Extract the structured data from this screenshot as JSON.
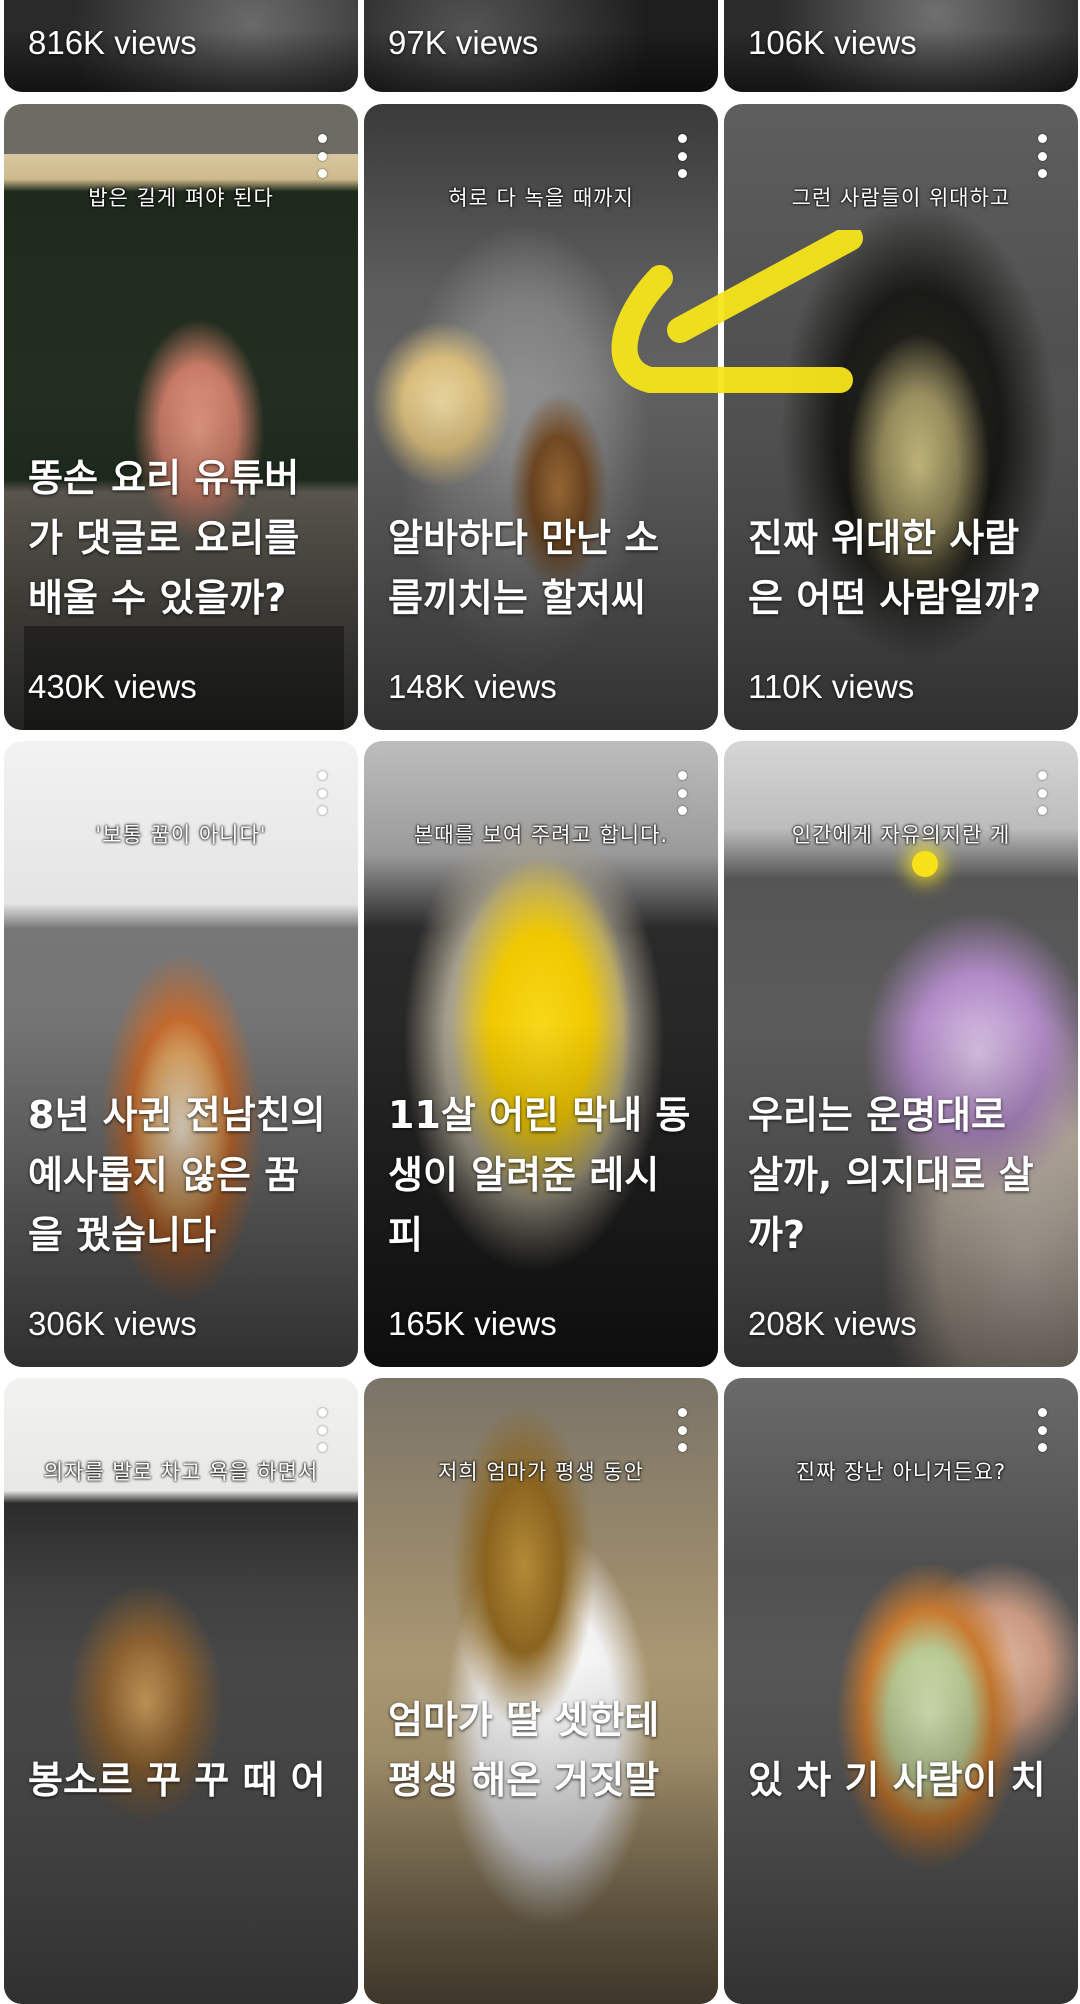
{
  "videos": [
    {
      "title": "",
      "caption": "",
      "views": "816K views",
      "bg": "#3c3c3c"
    },
    {
      "title": "",
      "caption": "",
      "views": "97K views",
      "bg": "#2e2e2e"
    },
    {
      "title": "",
      "caption": "",
      "views": "106K views",
      "bg": "#3a3a3a"
    },
    {
      "title": "똥손 요리 유튜버\n가 댓글로 요리를\n배울 수 있을까?",
      "caption": "밥은 길게 펴야 된다",
      "views": "430K views",
      "bg": "#5a5a52"
    },
    {
      "title": "알바하다 만난 소\n름끼치는 할저씨",
      "caption": "혀로 다 녹을 때까지",
      "views": "148K views",
      "bg": "#6a6a6a"
    },
    {
      "title": "진짜 위대한 사람\n은 어떤 사람일까?",
      "caption": "그런 사람들이 위대하고",
      "views": "110K views",
      "bg": "#585858"
    },
    {
      "title": "8년 사귄 전남친의\n예사롭지 않은 꿈\n을 꿨습니다",
      "caption": "'보통 꿈이 아니다'",
      "views": "306K views",
      "bg": "#6b6b6b"
    },
    {
      "title": "11살 어린 막내 동\n생이 알려준 레시\n피",
      "caption": "본때를 보여 주려고 합니다.",
      "views": "165K views",
      "bg": "#7d7c6d"
    },
    {
      "title": "우리는 운명대로\n살까, 의지대로 살\n까?",
      "caption": "인간에게 자유의지란 게",
      "views": "208K views",
      "bg": "#7a7a7a"
    },
    {
      "title": "봉소르 꾸 꾸 때 어",
      "caption": "의자를 발로 차고 욕을 하면서",
      "views": "",
      "bg": "#6e6e6e"
    },
    {
      "title": "엄마가 딸 셋한테\n평생 해온 거짓말",
      "caption": "저희 엄마가 평생 동안",
      "views": "",
      "bg": "#7c7468"
    },
    {
      "title": "있 차 기 사람이 치",
      "caption": "진짜 장난 아니거든요?",
      "views": "",
      "bg": "#6a6a6a"
    }
  ]
}
